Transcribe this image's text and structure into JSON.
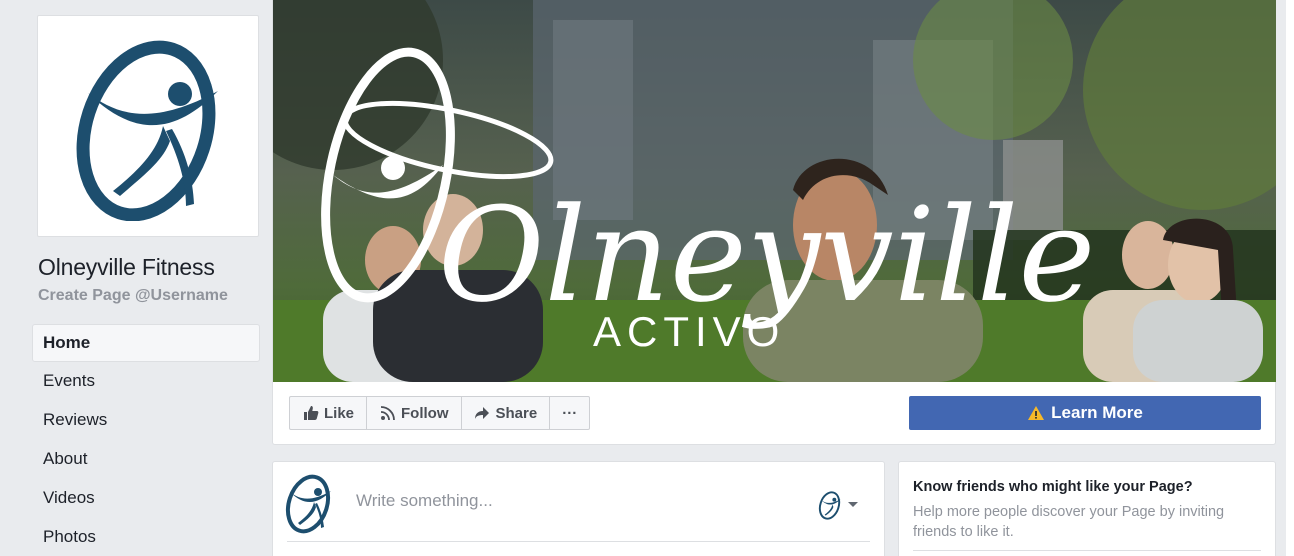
{
  "page": {
    "name": "Olneyville Fitness",
    "username_link": "Create Page @Username"
  },
  "nav": {
    "items": [
      {
        "label": "Home",
        "active": true
      },
      {
        "label": "Events"
      },
      {
        "label": "Reviews"
      },
      {
        "label": "About"
      },
      {
        "label": "Videos"
      },
      {
        "label": "Photos"
      }
    ]
  },
  "cover": {
    "logo_script": "Olneyville",
    "logo_sub": "ACTIVO"
  },
  "actions": {
    "like": "Like",
    "follow": "Follow",
    "share": "Share",
    "more": "···",
    "learn_more": "Learn More"
  },
  "composer": {
    "placeholder": "Write something..."
  },
  "invite": {
    "title": "Know friends who might like your Page?",
    "text": "Help more people discover your Page by inviting friends to like it."
  },
  "colors": {
    "brand_blue": "#4267b2",
    "logo_navy": "#1d4e6e",
    "warning": "#f7b928"
  },
  "icons": [
    "logo-icon",
    "like-icon",
    "follow-icon",
    "share-icon",
    "more-icon",
    "warning-icon",
    "dropdown-icon"
  ]
}
